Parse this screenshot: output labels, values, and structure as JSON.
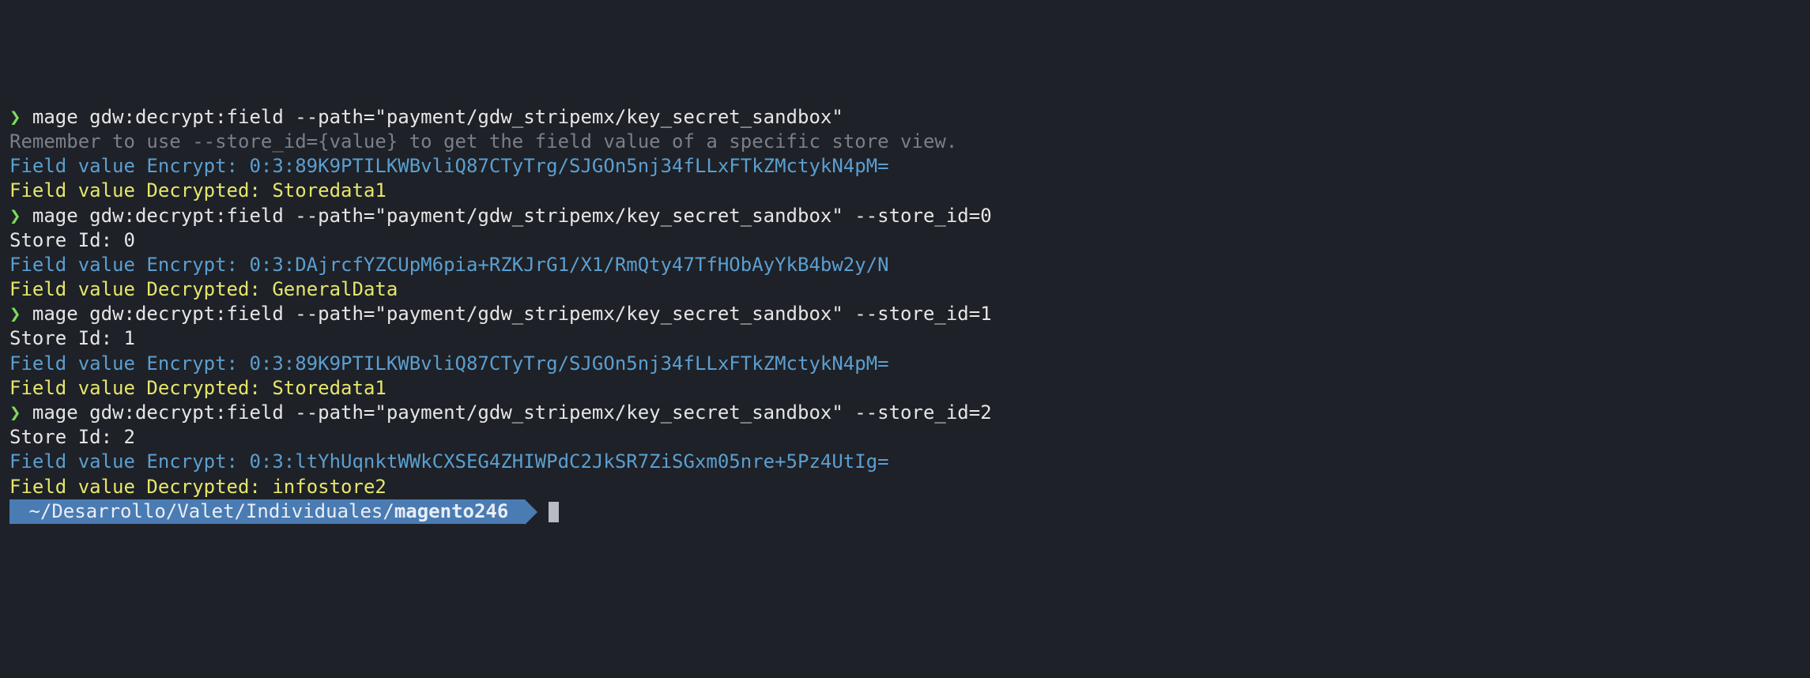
{
  "prompt_symbol": "❯",
  "runs": [
    {
      "command": "mage gdw:decrypt:field --path=\"payment/gdw_stripemx/key_secret_sandbox\"",
      "hint": "Remember to use --store_id={value} to get the field value of a specific store view.",
      "store_line": "",
      "encrypt_label": "Field value Encrypt: ",
      "encrypt_value": "0:3:89K9PTILKWBvliQ87CTyTrg/SJGOn5nj34fLLxFTkZMctykN4pM=",
      "decrypt_label": "Field value Decrypted: ",
      "decrypt_value": "Storedata1"
    },
    {
      "command": "mage gdw:decrypt:field --path=\"payment/gdw_stripemx/key_secret_sandbox\" --store_id=0",
      "hint": "",
      "store_line": "Store Id: 0",
      "encrypt_label": "Field value Encrypt: ",
      "encrypt_value": "0:3:DAjrcfYZCUpM6pia+RZKJrG1/X1/RmQty47TfHObAyYkB4bw2y/N",
      "decrypt_label": "Field value Decrypted: ",
      "decrypt_value": "GeneralData"
    },
    {
      "command": "mage gdw:decrypt:field --path=\"payment/gdw_stripemx/key_secret_sandbox\" --store_id=1",
      "hint": "",
      "store_line": "Store Id: 1",
      "encrypt_label": "Field value Encrypt: ",
      "encrypt_value": "0:3:89K9PTILKWBvliQ87CTyTrg/SJGOn5nj34fLLxFTkZMctykN4pM=",
      "decrypt_label": "Field value Decrypted: ",
      "decrypt_value": "Storedata1"
    },
    {
      "command": "mage gdw:decrypt:field --path=\"payment/gdw_stripemx/key_secret_sandbox\" --store_id=2",
      "hint": "",
      "store_line": "Store Id: 2",
      "encrypt_label": "Field value Encrypt: ",
      "encrypt_value": "0:3:ltYhUqnktWWkCXSEG4ZHIWPdC2JkSR7ZiSGxm05nre+5Pz4UtIg=",
      "decrypt_label": "Field value Decrypted: ",
      "decrypt_value": "infostore2"
    }
  ],
  "cwd_prefix": "~/Desarrollo/Valet/Individuales/",
  "cwd_dir": "magento246"
}
